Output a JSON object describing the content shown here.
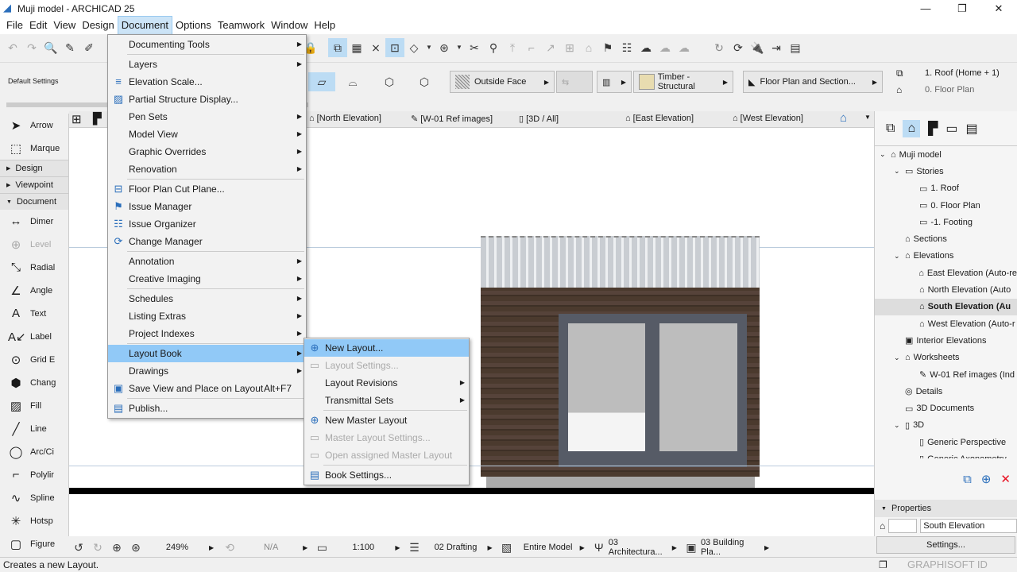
{
  "window": {
    "title": "Muji model - ARCHICAD 25",
    "controls": [
      "minimize",
      "maximize",
      "close"
    ]
  },
  "menubar": [
    "File",
    "Edit",
    "View",
    "Design",
    "Document",
    "Options",
    "Teamwork",
    "Window",
    "Help"
  ],
  "infobox": {
    "default_settings": "Default Settings",
    "surface": "Outside Face",
    "material": "Timber - Structural",
    "structure": "Floor Plan and Section...",
    "story_top": "1. Roof (Home + 1)",
    "story_bottom": "0. Floor Plan"
  },
  "tabs": [
    "[North Elevation]",
    "[W-01 Ref images]",
    "[3D / All]",
    "[East Elevation]",
    "[West Elevation]"
  ],
  "toolbox": {
    "tools_top": [
      "Arrow",
      "Marque"
    ],
    "groups": [
      "Design",
      "Viewpoint",
      "Document"
    ],
    "tools": [
      "Dimer",
      "Level",
      "Radial",
      "Angle",
      "Text",
      "Label",
      "Grid E",
      "Chang",
      "Fill",
      "Line",
      "Arc/Ci",
      "Polylir",
      "Spline",
      "Hotsp",
      "Figure"
    ]
  },
  "document_menu": [
    {
      "label": "Documenting Tools",
      "submenu": true
    },
    {
      "label": "Layers",
      "submenu": true
    },
    {
      "label": "Elevation Scale...",
      "icon": "elevation-scale"
    },
    {
      "label": "Partial Structure Display...",
      "icon": "partial-structure"
    },
    {
      "label": "Pen Sets",
      "submenu": true
    },
    {
      "label": "Model View",
      "submenu": true
    },
    {
      "label": "Graphic Overrides",
      "submenu": true
    },
    {
      "label": "Renovation",
      "submenu": true
    },
    {
      "label": "Floor Plan Cut Plane...",
      "icon": "cut-plane"
    },
    {
      "label": "Issue Manager",
      "icon": "flag"
    },
    {
      "label": "Issue Organizer",
      "icon": "issue-organizer"
    },
    {
      "label": "Change Manager",
      "icon": "change-manager"
    },
    {
      "label": "Annotation",
      "submenu": true
    },
    {
      "label": "Creative Imaging",
      "submenu": true
    },
    {
      "label": "Schedules",
      "submenu": true
    },
    {
      "label": "Listing Extras",
      "submenu": true
    },
    {
      "label": "Project Indexes",
      "submenu": true
    },
    {
      "label": "Layout Book",
      "submenu": true,
      "highlighted": true
    },
    {
      "label": "Drawings",
      "submenu": true
    },
    {
      "label": "Save View and Place on Layout",
      "shortcut": "Alt+F7",
      "icon": "save-view"
    },
    {
      "label": "Publish...",
      "icon": "publish"
    }
  ],
  "layout_book_submenu": [
    {
      "label": "New Layout...",
      "highlighted": true,
      "icon": "new-layout"
    },
    {
      "label": "Layout Settings...",
      "disabled": true,
      "icon": "layout-settings"
    },
    {
      "label": "Layout Revisions",
      "submenu": true
    },
    {
      "label": "Transmittal Sets",
      "submenu": true
    },
    {
      "label": "New Master Layout",
      "icon": "new-master"
    },
    {
      "label": "Master Layout Settings...",
      "disabled": true,
      "icon": "master-settings"
    },
    {
      "label": "Open assigned Master Layout",
      "disabled": true,
      "icon": "open-master"
    },
    {
      "label": "Book Settings...",
      "icon": "book-settings"
    }
  ],
  "navigator": {
    "nodes": [
      {
        "label": "Muji model",
        "level": 0,
        "exp": "v"
      },
      {
        "label": "Stories",
        "level": 1,
        "exp": "v"
      },
      {
        "label": "1. Roof",
        "level": 2
      },
      {
        "label": "0. Floor Plan",
        "level": 2
      },
      {
        "label": "-1. Footing",
        "level": 2
      },
      {
        "label": "Sections",
        "level": 1
      },
      {
        "label": "Elevations",
        "level": 1,
        "exp": "v"
      },
      {
        "label": "East Elevation (Auto-re",
        "level": 2
      },
      {
        "label": "North Elevation (Auto",
        "level": 2
      },
      {
        "label": "South Elevation (Au",
        "level": 2,
        "selected": true
      },
      {
        "label": "West Elevation (Auto-r",
        "level": 2
      },
      {
        "label": "Interior Elevations",
        "level": 1
      },
      {
        "label": "Worksheets",
        "level": 1,
        "exp": "v"
      },
      {
        "label": "W-01 Ref images (Ind",
        "level": 2
      },
      {
        "label": "Details",
        "level": 1
      },
      {
        "label": "3D Documents",
        "level": 1
      },
      {
        "label": "3D",
        "level": 1,
        "exp": "v"
      },
      {
        "label": "Generic Perspective",
        "level": 2
      },
      {
        "label": "Generic Axonometry",
        "level": 2
      }
    ],
    "properties_label": "Properties",
    "properties_value": "South Elevation",
    "settings_button": "Settings..."
  },
  "statusbar": {
    "zoom": "249%",
    "angle": "N/A",
    "scale": "1:100",
    "layer_combo": "02 Drafting",
    "model_view": "Entire Model",
    "pen_set": "03 Architectura...",
    "dim_style": "03 Building Pla..."
  },
  "message": "Creates a new Layout.",
  "graphisoft_id": "GRAPHISOFT ID",
  "colors": {
    "menu_highlight": "#91c9f7",
    "wall": "#4b3a2e",
    "door_frame": "#565b66",
    "glass": "#bdbdbd",
    "close_red": "#e81123"
  }
}
